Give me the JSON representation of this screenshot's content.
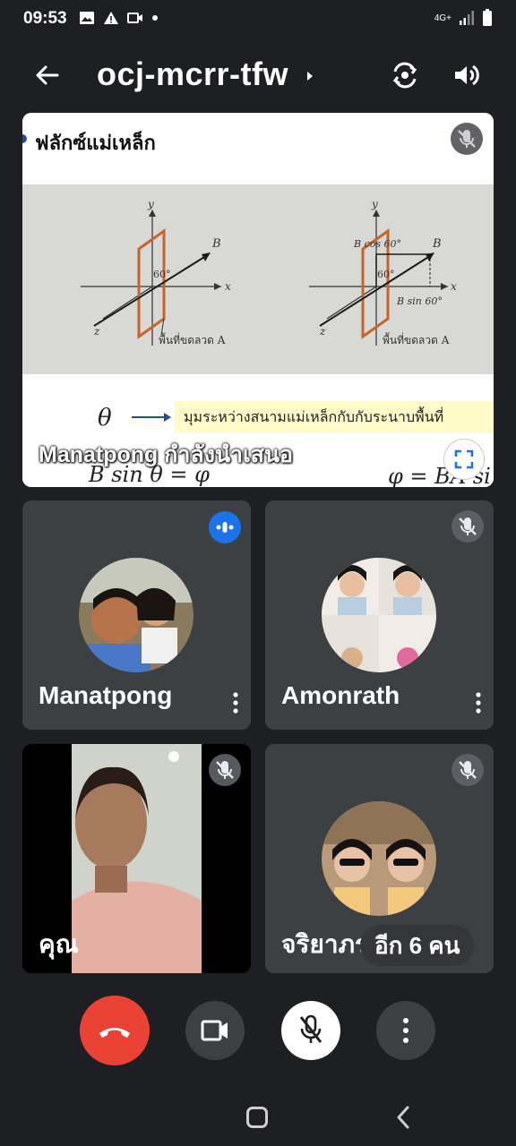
{
  "status_bar": {
    "time": "09:53",
    "network": "4G+",
    "icons_left": [
      "image-icon",
      "warning-icon",
      "video-icon",
      "dot-icon"
    ],
    "icons_right": [
      "signal-icon",
      "battery-icon"
    ]
  },
  "header": {
    "meeting_code": "ocj-mcrr-tfw",
    "icons": [
      "back-arrow-icon",
      "caret-right-icon",
      "camera-switch-icon",
      "speaker-icon"
    ]
  },
  "presentation": {
    "slide_title": "ฟลักซ์แม่เหล็ก",
    "theta_symbol": "θ",
    "theta_definition": "มุมระหว่างสนามแม่เหล็กกับกับระนาบพื้นที่",
    "formula_left": "B sin θ = φ",
    "formula_right": "φ = BA si",
    "diagram_left": {
      "axis_y": "y",
      "axis_x": "x",
      "axis_z": "z",
      "vector": "B",
      "angle": "60°",
      "area_label": "พื้นที่ขดลวด A"
    },
    "diagram_right": {
      "axis_y": "y",
      "axis_x": "x",
      "axis_z": "z",
      "vector": "B",
      "angle": "60°",
      "component_top": "B cos 60°",
      "component_right": "B sin 60°",
      "area_label": "พื้นที่ขดลวด A"
    },
    "caption": "Manatpong กำลังนำเสนอ",
    "colors": {
      "highlight": "#fffbc8",
      "frame": "#c8642a",
      "arrow": "#1f4e9c"
    }
  },
  "participants": [
    {
      "name": "Manatpong",
      "status": "speaking"
    },
    {
      "name": "Amonrath",
      "status": "muted"
    },
    {
      "name": "คุณ",
      "status": "muted"
    },
    {
      "name": "จริยาภรณ์",
      "status": "muted"
    }
  ],
  "more_people": "อีก 6 คน",
  "controls": {
    "icons": [
      "end-call-icon",
      "camera-icon",
      "mic-off-icon",
      "more-vert-icon"
    ],
    "colors": {
      "end_call": "#ea4335",
      "mic_active": "#ffffff",
      "speaking": "#1a73e8"
    }
  }
}
